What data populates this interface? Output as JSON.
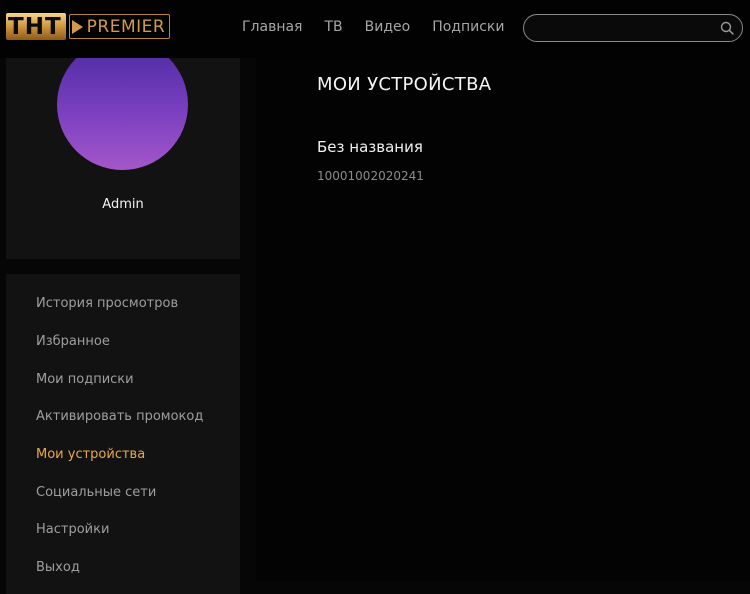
{
  "header": {
    "logo": {
      "tnt": "ТНТ",
      "premier": "PREMIER"
    },
    "nav": [
      "Главная",
      "ТВ",
      "Видео",
      "Подписки"
    ],
    "search": {
      "placeholder": "",
      "icon": "search-icon"
    }
  },
  "profile": {
    "username": "Admin",
    "avatar_colors": [
      "#4a2aa0",
      "#a457c8"
    ]
  },
  "menu": {
    "items": [
      {
        "label": "История просмотров",
        "active": false
      },
      {
        "label": "Избранное",
        "active": false
      },
      {
        "label": "Мои подписки",
        "active": false
      },
      {
        "label": "Активировать промокод",
        "active": false
      },
      {
        "label": "Мои устройства",
        "active": true
      },
      {
        "label": "Социальные сети",
        "active": false
      },
      {
        "label": "Настройки",
        "active": false
      },
      {
        "label": "Выход",
        "active": false
      }
    ],
    "active_color": "#e9a84a"
  },
  "main": {
    "title": "МОИ УСТРОЙСТВА",
    "devices": [
      {
        "name": "Без названия",
        "id": "10001002020241"
      }
    ]
  },
  "colors": {
    "brand_gold": "#d39a47",
    "background": "#060606"
  }
}
